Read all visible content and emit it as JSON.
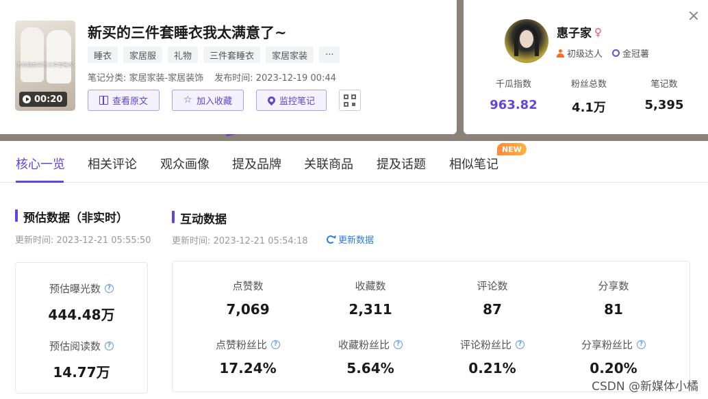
{
  "note": {
    "thumbnail_caption": "看看我新买的三件套睡衣",
    "duration": "00:20",
    "title": "新买的三件套睡衣我太满意了~",
    "tags": [
      "睡衣",
      "家居服",
      "礼物",
      "三件套睡衣",
      "家居家装",
      "···"
    ],
    "category": "笔记分类: 家居家装-家居装饰",
    "publish_time": "发布时间: 2023-12-19 00:44",
    "actions": {
      "view_original": "查看原文",
      "add_favorite": "加入收藏",
      "monitor_note": "监控笔记"
    }
  },
  "author": {
    "name": "惠子家",
    "gender_symbol": "♀",
    "level": "初级达人",
    "crown": "金冠薯",
    "stats": [
      {
        "label": "千瓜指数",
        "value": "963.82"
      },
      {
        "label": "粉丝总数",
        "value": "4.1万"
      },
      {
        "label": "笔记数",
        "value": "5,395"
      }
    ]
  },
  "tabs": [
    {
      "label": "核心一览",
      "active": true
    },
    {
      "label": "相关评论",
      "active": false
    },
    {
      "label": "观众画像",
      "active": false
    },
    {
      "label": "提及品牌",
      "active": false
    },
    {
      "label": "关联商品",
      "active": false
    },
    {
      "label": "提及话题",
      "active": false
    },
    {
      "label": "相似笔记",
      "active": false
    }
  ],
  "new_badge": "NEW",
  "estimate": {
    "title": "预估数据（非实时）",
    "updated": "更新时间: 2023-12-21 05:55:50",
    "items": [
      {
        "label": "预估曝光数",
        "value": "444.48万"
      },
      {
        "label": "预估阅读数",
        "value": "14.77万"
      }
    ]
  },
  "interaction": {
    "title": "互动数据",
    "updated": "更新时间: 2023-12-21 05:54:18",
    "refresh": "更新数据",
    "counts": [
      {
        "label": "点赞数",
        "value": "7,069"
      },
      {
        "label": "收藏数",
        "value": "2,311"
      },
      {
        "label": "评论数",
        "value": "87"
      },
      {
        "label": "分享数",
        "value": "81"
      }
    ],
    "ratios": [
      {
        "label": "点赞粉丝比",
        "value": "17.24%"
      },
      {
        "label": "收藏粉丝比",
        "value": "5.64%"
      },
      {
        "label": "评论粉丝比",
        "value": "0.21%"
      },
      {
        "label": "分享粉丝比",
        "value": "0.20%"
      }
    ]
  },
  "help_glyph": "?",
  "watermark": "CSDN @新媒体小橘",
  "colors": {
    "accent": "#6244e0",
    "link": "#2f7ae0",
    "new_badge": "#ff8a3d",
    "female": "#ff4d79"
  }
}
